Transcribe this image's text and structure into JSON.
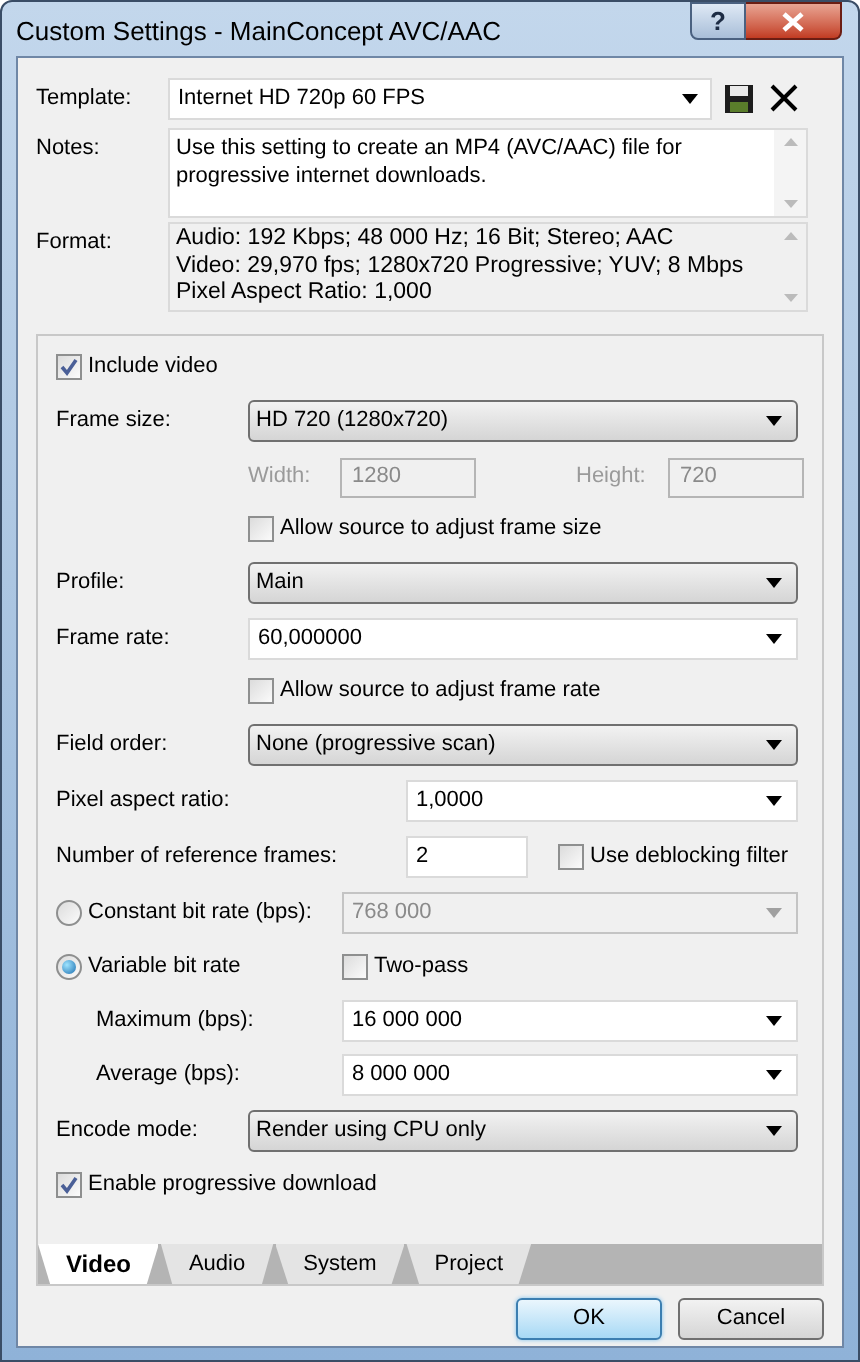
{
  "window": {
    "title": "Custom Settings - MainConcept AVC/AAC",
    "help": "?"
  },
  "template": {
    "label": "Template:",
    "value": "Internet HD 720p 60 FPS"
  },
  "notes": {
    "label": "Notes:",
    "value": "Use this setting to create an MP4 (AVC/AAC) file for progressive internet downloads."
  },
  "format": {
    "label": "Format:",
    "lines": [
      "Audio: 192 Kbps; 48 000 Hz; 16 Bit; Stereo; AAC",
      "Video: 29,970 fps; 1280x720 Progressive; YUV; 8 Mbps",
      "Pixel Aspect Ratio: 1,000"
    ]
  },
  "settings": [
    {
      "kind": "checkbox",
      "label": "Include video",
      "checked": true
    },
    {
      "kind": "select",
      "label": "Frame size:",
      "value": "HD 720 (1280x720)"
    },
    {
      "kind": "dimensions",
      "disabled": true,
      "fields": [
        {
          "label": "Width:",
          "value": "1280"
        },
        {
          "label": "Height:",
          "value": "720"
        }
      ]
    },
    {
      "kind": "sub_checkbox",
      "label": "Allow source to adjust frame size",
      "checked": false
    },
    {
      "kind": "select",
      "label": "Profile:",
      "value": "Main"
    },
    {
      "kind": "combo",
      "label": "Frame rate:",
      "value": "60,000000"
    },
    {
      "kind": "sub_checkbox",
      "label": "Allow source to adjust frame rate",
      "checked": false
    },
    {
      "kind": "select",
      "label": "Field order:",
      "value": "None (progressive scan)"
    },
    {
      "kind": "wide_combo",
      "label": "Pixel aspect ratio:",
      "value": "1,0000"
    },
    {
      "kind": "number_checkbox",
      "label": "Number of reference frames:",
      "value": "2",
      "checkbox": {
        "label": "Use deblocking filter",
        "checked": false
      }
    },
    {
      "kind": "radio_combo",
      "label": "Constant bit rate (bps):",
      "selected": false,
      "value": "768 000",
      "disabled": true
    },
    {
      "kind": "radio_checkbox",
      "label": "Variable bit rate",
      "selected": true,
      "checkbox": {
        "label": "Two-pass",
        "checked": false
      }
    },
    {
      "kind": "sub_combo",
      "label": "Maximum (bps):",
      "value": "16 000 000"
    },
    {
      "kind": "sub_combo",
      "label": "Average (bps):",
      "value": "8 000 000"
    },
    {
      "kind": "select",
      "label": "Encode mode:",
      "value": "Render using CPU only"
    },
    {
      "kind": "checkbox",
      "label": "Enable progressive download",
      "checked": true
    }
  ],
  "tabs": [
    {
      "label": "Video",
      "selected": true
    },
    {
      "label": "Audio",
      "selected": false
    },
    {
      "label": "System",
      "selected": false
    },
    {
      "label": "Project",
      "selected": false
    }
  ],
  "buttons": [
    {
      "label": "OK",
      "default": true
    },
    {
      "label": "Cancel",
      "default": false
    }
  ]
}
